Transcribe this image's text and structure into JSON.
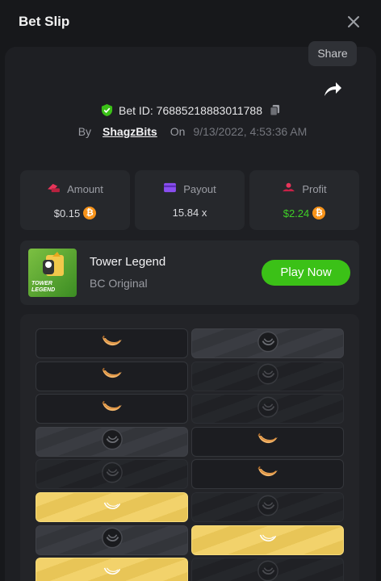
{
  "header": {
    "title": "Bet Slip"
  },
  "share": {
    "label": "Share"
  },
  "bet": {
    "id_label": "Bet ID: 76885218883011788",
    "by_label": "By",
    "user": "ShagzBits",
    "on_label": "On",
    "date": "9/13/2022, 4:53:36 AM"
  },
  "stats": {
    "amount": {
      "label": "Amount",
      "value": "$0.15"
    },
    "payout": {
      "label": "Payout",
      "value": "15.84 x"
    },
    "profit": {
      "label": "Profit",
      "value": "$2.24"
    }
  },
  "game": {
    "name": "Tower Legend",
    "subtitle": "BC Original",
    "thumb_text": "TOWER LEGEND",
    "play_label": "Play Now"
  },
  "board": {
    "rows": [
      [
        "banana",
        "skull-dark"
      ],
      [
        "banana",
        "skull-dim"
      ],
      [
        "banana",
        "skull-dim"
      ],
      [
        "skull-dark",
        "banana"
      ],
      [
        "skull-dim",
        "banana"
      ],
      [
        "gold",
        "skull-dim"
      ],
      [
        "skull-dark",
        "gold"
      ],
      [
        "gold",
        "skull-dim"
      ]
    ]
  },
  "colors": {
    "accent_green": "#3bc117",
    "profit_green": "#3fce27",
    "btc_orange": "#f7931a",
    "gold": "#f2d26b"
  },
  "icons": [
    "close-icon",
    "share-arrow-icon",
    "shield-check-icon",
    "copy-icon",
    "amount-icon",
    "payout-card-icon",
    "profit-icon",
    "bitcoin-icon",
    "banana-icon",
    "skull-coin-icon"
  ]
}
